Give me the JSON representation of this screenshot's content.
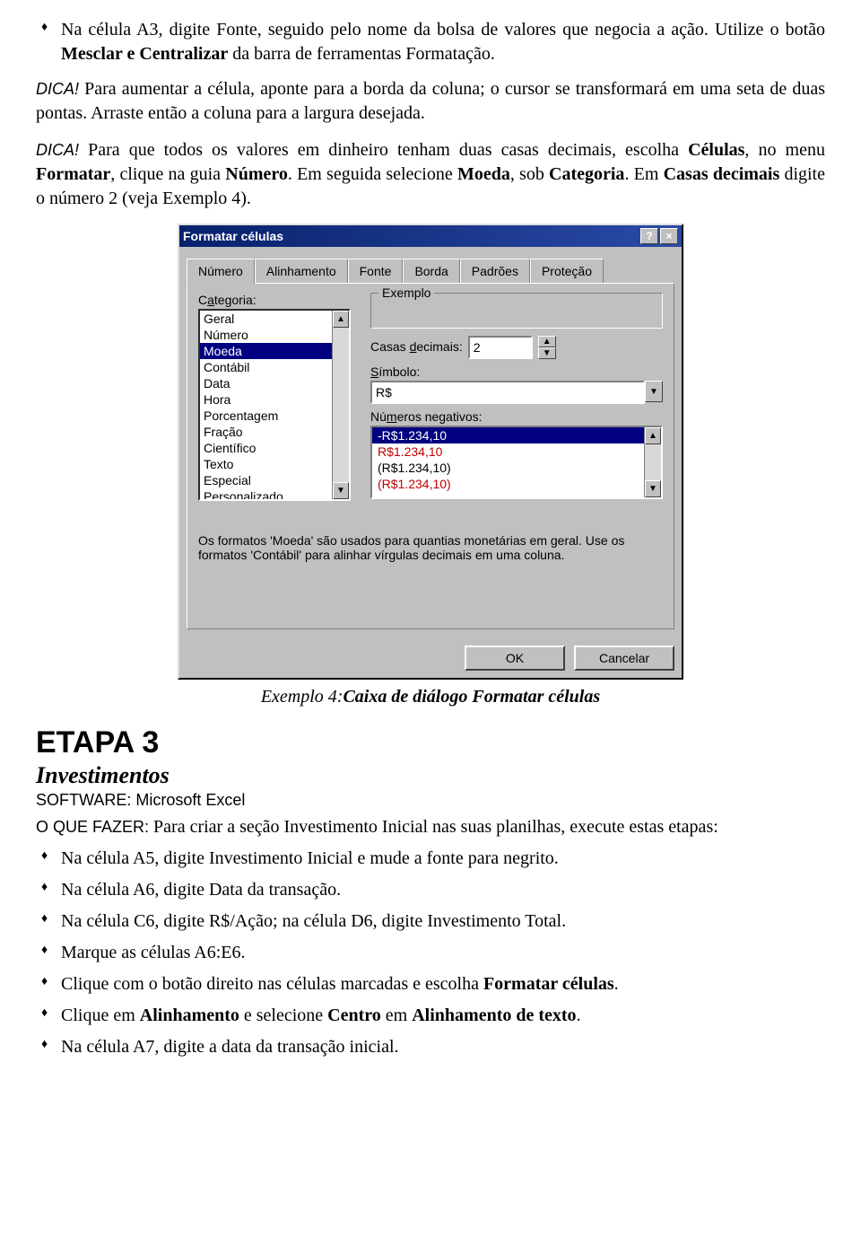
{
  "intro": {
    "bullet1_a": "Na célula A3, digite Fonte, seguido pelo nome da bolsa de valores que negocia a ação. Utilize o botão ",
    "bullet1_b": "Mesclar e Centralizar",
    "bullet1_c": " da barra de ferramentas Formatação."
  },
  "dica1": {
    "label": "DICA!",
    "text": " Para aumentar a célula, aponte para a borda da coluna; o cursor se transformará em uma seta de duas pontas. Arraste então a coluna para a largura desejada."
  },
  "dica2": {
    "label": "DICA!",
    "t1": " Para que todos os valores em dinheiro tenham duas casas decimais, escolha ",
    "b1": "Células",
    "t2": ", no menu ",
    "b2": "Formatar",
    "t3": ", clique na guia ",
    "b3": "Número",
    "t4": ". Em seguida selecione ",
    "b4": "Moeda",
    "t5": ", sob ",
    "b5": "Categoria",
    "t6": ". Em ",
    "b6": "Casas decimais",
    "t7": " digite o número 2 (veja Exemplo 4)."
  },
  "dialog": {
    "title": "Formatar células",
    "help_glyph": "?",
    "close_glyph": "×",
    "tabs": [
      "Número",
      "Alinhamento",
      "Fonte",
      "Borda",
      "Padrões",
      "Proteção"
    ],
    "categoria_label_pre": "C",
    "categoria_label_u": "a",
    "categoria_label_post": "tegoria:",
    "categories": [
      "Geral",
      "Número",
      "Moeda",
      "Contábil",
      "Data",
      "Hora",
      "Porcentagem",
      "Fração",
      "Científico",
      "Texto",
      "Especial",
      "Personalizado"
    ],
    "category_selected_index": 2,
    "exemplo_label": "Exemplo",
    "decimals_label_pre": "Casas ",
    "decimals_label_u": "d",
    "decimals_label_post": "ecimais:",
    "decimals_value": "2",
    "symbol_label_u": "S",
    "symbol_label_post": "ímbolo:",
    "symbol_value": "R$",
    "negatives_label_pre": "Nú",
    "negatives_label_u": "m",
    "negatives_label_post": "eros negativos:",
    "negatives": [
      "-R$1.234,10",
      "R$1.234,10",
      "(R$1.234,10)",
      "(R$1.234,10)"
    ],
    "negatives_selected_index": 0,
    "hint": "Os formatos 'Moeda' são usados para quantias monetárias em geral. Use os formatos 'Contábil' para alinhar vírgulas decimais em uma coluna.",
    "ok": "OK",
    "cancel": "Cancelar",
    "up_glyph": "▲",
    "down_glyph": "▼"
  },
  "caption": {
    "prefix": "Exemplo 4:",
    "text": "Caixa de diálogo Formatar células"
  },
  "etapa": {
    "heading": "ETAPA 3",
    "subtitle": "Investimentos",
    "software_label": "SOFTWARE: ",
    "software_value": "Microsoft Excel",
    "todo_label": "O QUE FAZER:",
    "todo_text": " Para criar a seção Investimento Inicial nas suas planilhas, execute estas etapas:",
    "bullets": {
      "b1": "Na célula A5, digite Investimento Inicial e mude a fonte para negrito.",
      "b2": "Na célula A6, digite Data da transação.",
      "b3": "Na célula C6, digite R$/Ação; na célula D6, digite Investimento Total.",
      "b4": "Marque as células A6:E6.",
      "b5_a": "Clique com o botão direito nas células marcadas e escolha ",
      "b5_b": "Formatar células",
      "b5_c": ".",
      "b6_a": "Clique em ",
      "b6_b": "Alinhamento",
      "b6_c": " e selecione ",
      "b6_d": "Centro",
      "b6_e": " em ",
      "b6_f": "Alinhamento de texto",
      "b6_g": ".",
      "b7": "Na célula A7, digite a data da transação inicial."
    }
  }
}
